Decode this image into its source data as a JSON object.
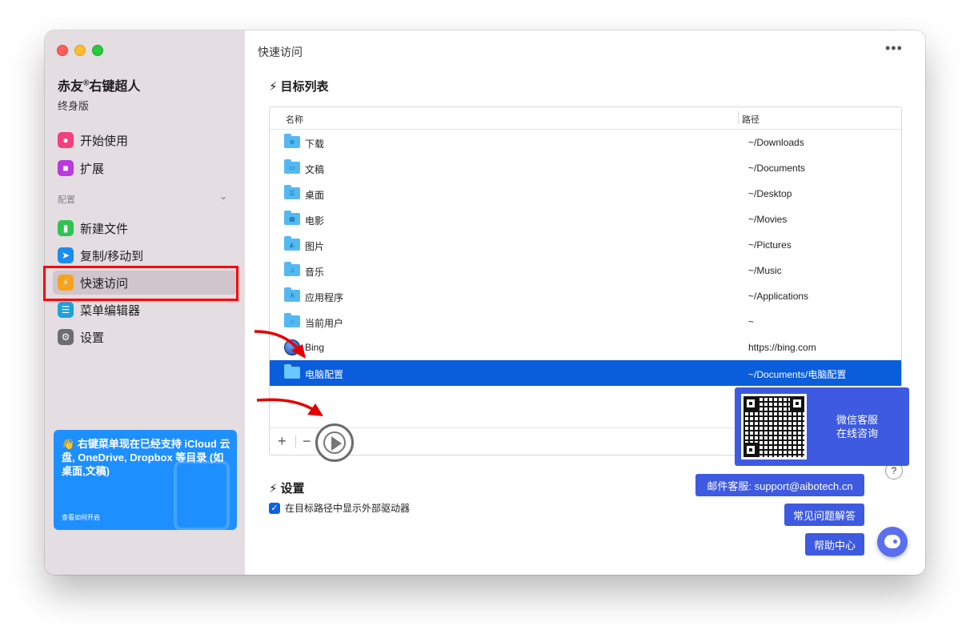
{
  "window": {
    "title": "快速访问"
  },
  "sidebar": {
    "app_name": "赤友",
    "app_mark": "®",
    "app_suffix": "右键超人",
    "edition": "终身版",
    "top_items": [
      {
        "label": "开始使用",
        "icon": "lightbulb-icon",
        "color": "#f2407a"
      },
      {
        "label": "扩展",
        "icon": "extension-icon",
        "color": "#b83bdc"
      }
    ],
    "section_label": "配置",
    "config_items": [
      {
        "label": "新建文件",
        "icon": "new-file-icon",
        "color": "#2ec44f"
      },
      {
        "label": "复制/移动到",
        "icon": "send-icon",
        "color": "#1b8cf0"
      },
      {
        "label": "快速访问",
        "icon": "lightning-icon",
        "color": "#f7a21b",
        "active": true
      },
      {
        "label": "菜单编辑器",
        "icon": "list-icon",
        "color": "#1fa0d8"
      },
      {
        "label": "设置",
        "icon": "gear-icon",
        "color": "#6d6d6d"
      }
    ],
    "promo": {
      "emoji": "👋",
      "text": "右键菜单现在已经支持 iCloud 云盘, OneDrive, Dropbox 等目录 (如桌面,文稿)",
      "link": "查看如何开启"
    }
  },
  "main": {
    "more": "•••",
    "target_section": {
      "icon": "lightning-icon",
      "title": "目标列表"
    },
    "table": {
      "columns": [
        "名称",
        "路径"
      ],
      "rows": [
        {
          "name": "下载",
          "path": "~/Downloads",
          "icon": "downloads-folder-icon",
          "glyph": "⊕"
        },
        {
          "name": "文稿",
          "path": "~/Documents",
          "icon": "documents-folder-icon",
          "glyph": "▭"
        },
        {
          "name": "桌面",
          "path": "~/Desktop",
          "icon": "desktop-folder-icon",
          "glyph": "☰"
        },
        {
          "name": "电影",
          "path": "~/Movies",
          "icon": "movies-folder-icon",
          "glyph": "▦"
        },
        {
          "name": "图片",
          "path": "~/Pictures",
          "icon": "pictures-folder-icon",
          "glyph": "◭"
        },
        {
          "name": "音乐",
          "path": "~/Music",
          "icon": "music-folder-icon",
          "glyph": "♫"
        },
        {
          "name": "应用程序",
          "path": "~/Applications",
          "icon": "applications-folder-icon",
          "glyph": "A"
        },
        {
          "name": "当前用户",
          "path": "~",
          "icon": "home-folder-icon",
          "glyph": "⌂"
        },
        {
          "name": "Bing",
          "path": "https://bing.com",
          "icon": "globe-icon",
          "glyph": ""
        },
        {
          "name": "电脑配置",
          "path": "~/Documents/电脑配置",
          "icon": "folder-icon",
          "glyph": "",
          "selected": true
        }
      ],
      "add_label": "+",
      "remove_label": "−"
    },
    "settings_section": {
      "icon": "lightning-icon",
      "title": "设置"
    },
    "show_external_drives": {
      "label": "在目标路径中显示外部驱动器",
      "checked": true,
      "check_glyph": "✓"
    }
  },
  "support": {
    "wechat": "微信客服\n在线咨询",
    "email": "邮件客服: support@aibotech.cn",
    "faq": "常见问题解答",
    "help_center": "帮助中心",
    "help_symbol": "?",
    "accent": "#3e5ae0"
  }
}
